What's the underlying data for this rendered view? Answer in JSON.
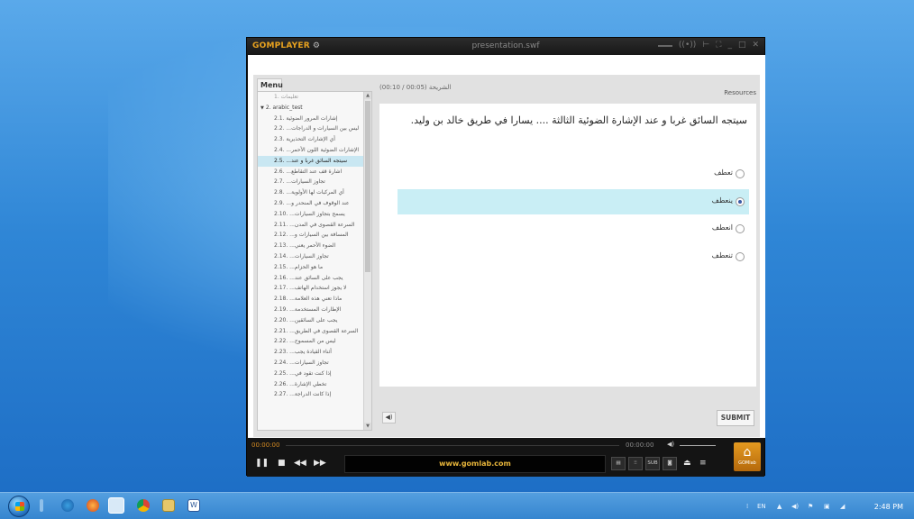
{
  "window": {
    "brand": "GOMPLAYER",
    "title": "presentation.swf"
  },
  "menu": {
    "tab_label": "Menu",
    "items": [
      {
        "label": "1. تعليمات",
        "type": "item",
        "dim": true
      },
      {
        "label": "2. arabic_test",
        "type": "folder"
      },
      {
        "label": "2.1. إشارات المرور الضوئية",
        "type": "item"
      },
      {
        "label": "2.2. ...ليس بين السيارات و الدراجات",
        "type": "item"
      },
      {
        "label": "2.3. أي الإشارات التحذيرية",
        "type": "item"
      },
      {
        "label": "2.4. ...الإشارات الضوئية اللون الأحمر",
        "type": "item"
      },
      {
        "label": "2.5. ...سيتجه السائق غربا و عند",
        "type": "item",
        "selected": true
      },
      {
        "label": "2.6. ...اشارة قف عند التقاطع",
        "type": "item"
      },
      {
        "label": "2.7. ...تجاوز السيارات",
        "type": "item"
      },
      {
        "label": "2.8. ...أي المركبات لها الأولوية",
        "type": "item"
      },
      {
        "label": "2.9. ...عند الوقوف في المنحدر و",
        "type": "item"
      },
      {
        "label": "2.10. ...يسمح بتجاوز السيارات",
        "type": "item"
      },
      {
        "label": "2.11. ...السرعة القصوى في المدن",
        "type": "item"
      },
      {
        "label": "2.12. ...المسافة بين السيارات و",
        "type": "item"
      },
      {
        "label": "2.13. ...الضوء الأحمر يعني",
        "type": "item"
      },
      {
        "label": "2.14. ...تجاوز السيارات",
        "type": "item"
      },
      {
        "label": "2.15. ...ما هو الحزام",
        "type": "item"
      },
      {
        "label": "2.16. ...يجب على السائق عند",
        "type": "item"
      },
      {
        "label": "2.17. ...لا يجوز استخدام الهاتف",
        "type": "item"
      },
      {
        "label": "2.18. ...ماذا تعني هذه العلامة",
        "type": "item"
      },
      {
        "label": "2.19. ...الإطارات المستخدمة",
        "type": "item"
      },
      {
        "label": "2.20. ...يجب على السائقين",
        "type": "item"
      },
      {
        "label": "2.21. ...السرعة القصوى في الطريق",
        "type": "item"
      },
      {
        "label": "2.22. ...ليس من المسموح",
        "type": "item"
      },
      {
        "label": "2.23. ...أثناء القيادة يجب",
        "type": "item"
      },
      {
        "label": "2.24. ...تجاوز السيارات",
        "type": "item"
      },
      {
        "label": "2.25. ...إذا كنت تقود في",
        "type": "item"
      },
      {
        "label": "2.26. ...تخطي الإشارة",
        "type": "item"
      },
      {
        "label": "2.27. ...إذا كانت الدراجة",
        "type": "item"
      }
    ]
  },
  "slide": {
    "progress_label": "الشريحة (00:05 / 00:10)",
    "resources_label": "Resources",
    "question": "سيتجه السائق غربا و عند الإشارة الضوئية الثالثة .... يسارا في طريق خالد بن وليد.",
    "options": [
      {
        "label": "تعطف",
        "selected": false
      },
      {
        "label": "ينعطف",
        "selected": true
      },
      {
        "label": "انعطف",
        "selected": false
      },
      {
        "label": "تنعطف",
        "selected": false
      }
    ],
    "submit_label": "SUBMIT"
  },
  "controls": {
    "time_elapsed": "00:00:00",
    "time_total": "00:00:00",
    "url": "www.gomlab.com",
    "sub_label": "SUB",
    "logo_label": "GOMlab"
  },
  "taskbar": {
    "language": "EN",
    "clock": "2:48 PM"
  }
}
